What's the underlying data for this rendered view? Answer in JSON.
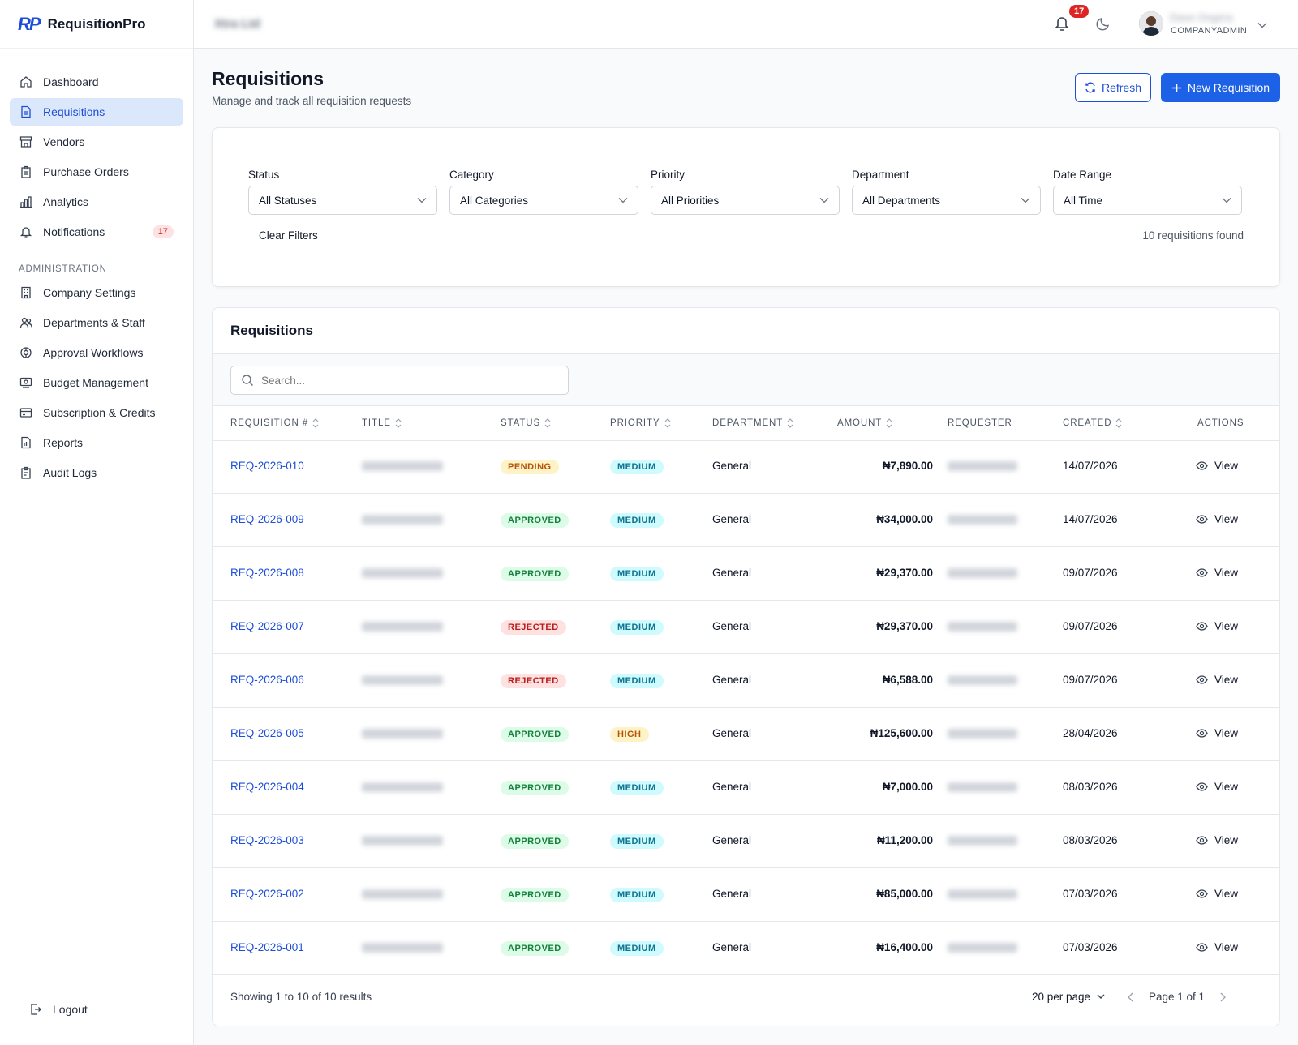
{
  "brand": {
    "logo": "RP",
    "name": "RequisitionPro"
  },
  "topbar": {
    "company": "Xtra Ltd",
    "notifications_count": "17",
    "user_name": "Dave Ongera",
    "user_role": "COMPANYADMIN"
  },
  "sidebar": {
    "items": [
      {
        "label": "Dashboard",
        "icon": "home-icon"
      },
      {
        "label": "Requisitions",
        "icon": "document-icon",
        "active": true
      },
      {
        "label": "Vendors",
        "icon": "store-icon"
      },
      {
        "label": "Purchase Orders",
        "icon": "clipboard-icon"
      },
      {
        "label": "Analytics",
        "icon": "bar-chart-icon"
      },
      {
        "label": "Notifications",
        "icon": "bell-icon",
        "badge": "17"
      }
    ],
    "admin_section": "ADMINISTRATION",
    "admin_items": [
      {
        "label": "Company Settings",
        "icon": "building-icon"
      },
      {
        "label": "Departments & Staff",
        "icon": "users-icon"
      },
      {
        "label": "Approval Workflows",
        "icon": "workflow-icon"
      },
      {
        "label": "Budget Management",
        "icon": "budget-icon"
      },
      {
        "label": "Subscription & Credits",
        "icon": "credit-card-icon"
      },
      {
        "label": "Reports",
        "icon": "report-icon"
      },
      {
        "label": "Audit Logs",
        "icon": "audit-icon"
      }
    ],
    "logout": "Logout"
  },
  "page": {
    "title": "Requisitions",
    "subtitle": "Manage and track all requisition requests",
    "refresh": "Refresh",
    "new": "New Requisition"
  },
  "filters": {
    "status": {
      "label": "Status",
      "value": "All Statuses"
    },
    "category": {
      "label": "Category",
      "value": "All Categories"
    },
    "priority": {
      "label": "Priority",
      "value": "All Priorities"
    },
    "department": {
      "label": "Department",
      "value": "All Departments"
    },
    "date": {
      "label": "Date Range",
      "value": "All Time"
    },
    "clear": "Clear Filters",
    "found": "10 requisitions found"
  },
  "table": {
    "title": "Requisitions",
    "search_placeholder": "Search...",
    "headers": {
      "req": "REQUISITION #",
      "title": "TITLE",
      "status": "STATUS",
      "priority": "PRIORITY",
      "department": "DEPARTMENT",
      "amount": "AMOUNT",
      "requester": "REQUESTER",
      "created": "CREATED",
      "actions": "ACTIONS"
    },
    "view_label": "View",
    "rows": [
      {
        "id": "REQ-2026-010",
        "title": "Stationery test",
        "status": "PENDING",
        "priority": "MEDIUM",
        "department": "General",
        "amount": "₦7,890.00",
        "requester": "Dave Ongera",
        "created": "14/07/2026"
      },
      {
        "id": "REQ-2026-009",
        "title": "Test Request 01",
        "status": "APPROVED",
        "priority": "MEDIUM",
        "department": "General",
        "amount": "₦34,000.00",
        "requester": "Dave Ongera",
        "created": "14/07/2026"
      },
      {
        "id": "REQ-2026-008",
        "title": "Training request",
        "status": "APPROVED",
        "priority": "MEDIUM",
        "department": "General",
        "amount": "₦29,370.00",
        "requester": "Dave Ongera",
        "created": "09/07/2026"
      },
      {
        "id": "REQ-2026-007",
        "title": "Training request",
        "status": "REJECTED",
        "priority": "MEDIUM",
        "department": "General",
        "amount": "₦29,370.00",
        "requester": "Dave Ongera",
        "created": "09/07/2026"
      },
      {
        "id": "REQ-2026-006",
        "title": "Training",
        "status": "REJECTED",
        "priority": "MEDIUM",
        "department": "General",
        "amount": "₦6,588.00",
        "requester": "Dave Ongera",
        "created": "09/07/2026"
      },
      {
        "id": "REQ-2026-005",
        "title": "Stationery Supp",
        "status": "APPROVED",
        "priority": "HIGH",
        "department": "General",
        "amount": "₦125,600.00",
        "requester": "Dave Ongera",
        "created": "28/04/2026"
      },
      {
        "id": "REQ-2026-004",
        "title": "Test PO Locatio",
        "status": "APPROVED",
        "priority": "MEDIUM",
        "department": "General",
        "amount": "₦7,000.00",
        "requester": "Dave Ongera",
        "created": "08/03/2026"
      },
      {
        "id": "REQ-2026-003",
        "title": "Test for Item01",
        "status": "APPROVED",
        "priority": "MEDIUM",
        "department": "General",
        "amount": "₦11,200.00",
        "requester": "Dave Ongera",
        "created": "08/03/2026"
      },
      {
        "id": "REQ-2026-002",
        "title": "Test Number 2",
        "status": "APPROVED",
        "priority": "MEDIUM",
        "department": "General",
        "amount": "₦85,000.00",
        "requester": "Dave Ongera",
        "created": "07/03/2026"
      },
      {
        "id": "REQ-2026-001",
        "title": "Request 001",
        "status": "APPROVED",
        "priority": "MEDIUM",
        "department": "General",
        "amount": "₦16,400.00",
        "requester": "Dave Ongera",
        "created": "07/03/2026"
      }
    ],
    "footer": {
      "showing": "Showing 1 to 10 of 10 results",
      "per_page": "20 per page",
      "page": "Page 1 of 1"
    }
  }
}
